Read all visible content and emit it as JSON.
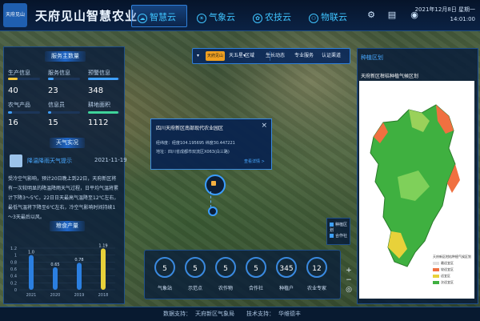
{
  "header": {
    "logo_text": "天府见山",
    "title": "天府见山智慧农业",
    "tabs": [
      "智慧云",
      "气象云",
      "农技云",
      "物联云"
    ],
    "active_tab": 0,
    "date": "2021年12月8日 星期一",
    "time": "14:01:00"
  },
  "left_panel": {
    "service_title": "服务主数量",
    "stats": [
      {
        "label": "生产信息",
        "value": "40",
        "fill": 0.3,
        "color": "#f5c63a"
      },
      {
        "label": "服务信息",
        "value": "23",
        "fill": 0.18,
        "color": "#3fa0ff"
      },
      {
        "label": "预警信息",
        "value": "348",
        "fill": 0.95,
        "color": "#3fa0ff"
      },
      {
        "label": "农气产品",
        "value": "16",
        "fill": 0.12,
        "color": "#3fa0ff"
      },
      {
        "label": "信息员",
        "value": "15",
        "fill": 0.1,
        "color": "#3fa0ff"
      },
      {
        "label": "耕地面积",
        "value": "1112",
        "fill": 0.95,
        "color": "#3fd49a"
      }
    ],
    "weather_title": "天气实况",
    "weather_headline": "降温降雨天气提示",
    "weather_date": "2021-11-19",
    "weather_text": "受冷空气影响，预计20日晚上到22日，天府新区将有一次较明显的降温降雨天气过程，日平均气温将累计下降3～5℃，22日日天最高气温降至12℃左右，最低气温将下降至6℃左右，冷空气影响时间持续1～3天最后以风。",
    "production_title": "粮食产量",
    "chart_data": {
      "type": "bar",
      "categories": [
        "2021",
        "2020",
        "2019",
        "2018"
      ],
      "values": [
        1.0,
        0.65,
        0.78,
        1.19
      ],
      "data_labels": [
        "1.0",
        "0.65",
        "0.78",
        "1.19"
      ],
      "yticks": [
        "1.2",
        "1",
        "0.8",
        "0.6",
        "0.4",
        "0.2",
        "0"
      ],
      "ylim": [
        0,
        1.2
      ],
      "colors": [
        "#2b7fe0",
        "#2b7fe0",
        "#2b7fe0",
        "#e8d13a"
      ]
    }
  },
  "toolbar": {
    "logo": "天府见山",
    "location": "天五星",
    "items": [
      "区域",
      "生长动态",
      "专业服务",
      "认证渠道"
    ]
  },
  "popup": {
    "title": "四川天府新区南部现代农业园区",
    "coords": "经纬度：经度104.195695 纬度30.447221",
    "address": "地址：四川省成都市双流区X063(白三路)",
    "link": "查看详情 >",
    "close": "×"
  },
  "bottom_stats": [
    {
      "value": "5",
      "label": "气象站"
    },
    {
      "value": "5",
      "label": "示范点"
    },
    {
      "value": "5",
      "label": "农作物"
    },
    {
      "value": "5",
      "label": "合作社"
    },
    {
      "value": "345",
      "label": "种植户"
    },
    {
      "value": "12",
      "label": "农业专家"
    }
  ],
  "map_legend": [
    {
      "label": "种植区划",
      "color": "#3fa0ff"
    },
    {
      "label": "合作社",
      "color": "#3fa0ff"
    }
  ],
  "zoom": {
    "in": "+",
    "out": "−",
    "reset": "◎"
  },
  "right_panel": {
    "title": "种植区划",
    "subtitle": "天府新区柑桔种植气候区划",
    "legend": [
      {
        "label": "天府新区柑桔种植气候区划",
        "color": ""
      },
      {
        "label": "最适宜区",
        "color": "#e0e0e0"
      },
      {
        "label": "较适宜区",
        "color": "#f07040"
      },
      {
        "label": "适宜区",
        "color": "#e8d13a"
      },
      {
        "label": "次适宜区",
        "color": "#3fb040"
      }
    ]
  },
  "footer": {
    "support_label": "数据支持：",
    "support_value": "天府新区气象局",
    "tech_label": "技术支持：",
    "tech_value": "华维德丰"
  }
}
